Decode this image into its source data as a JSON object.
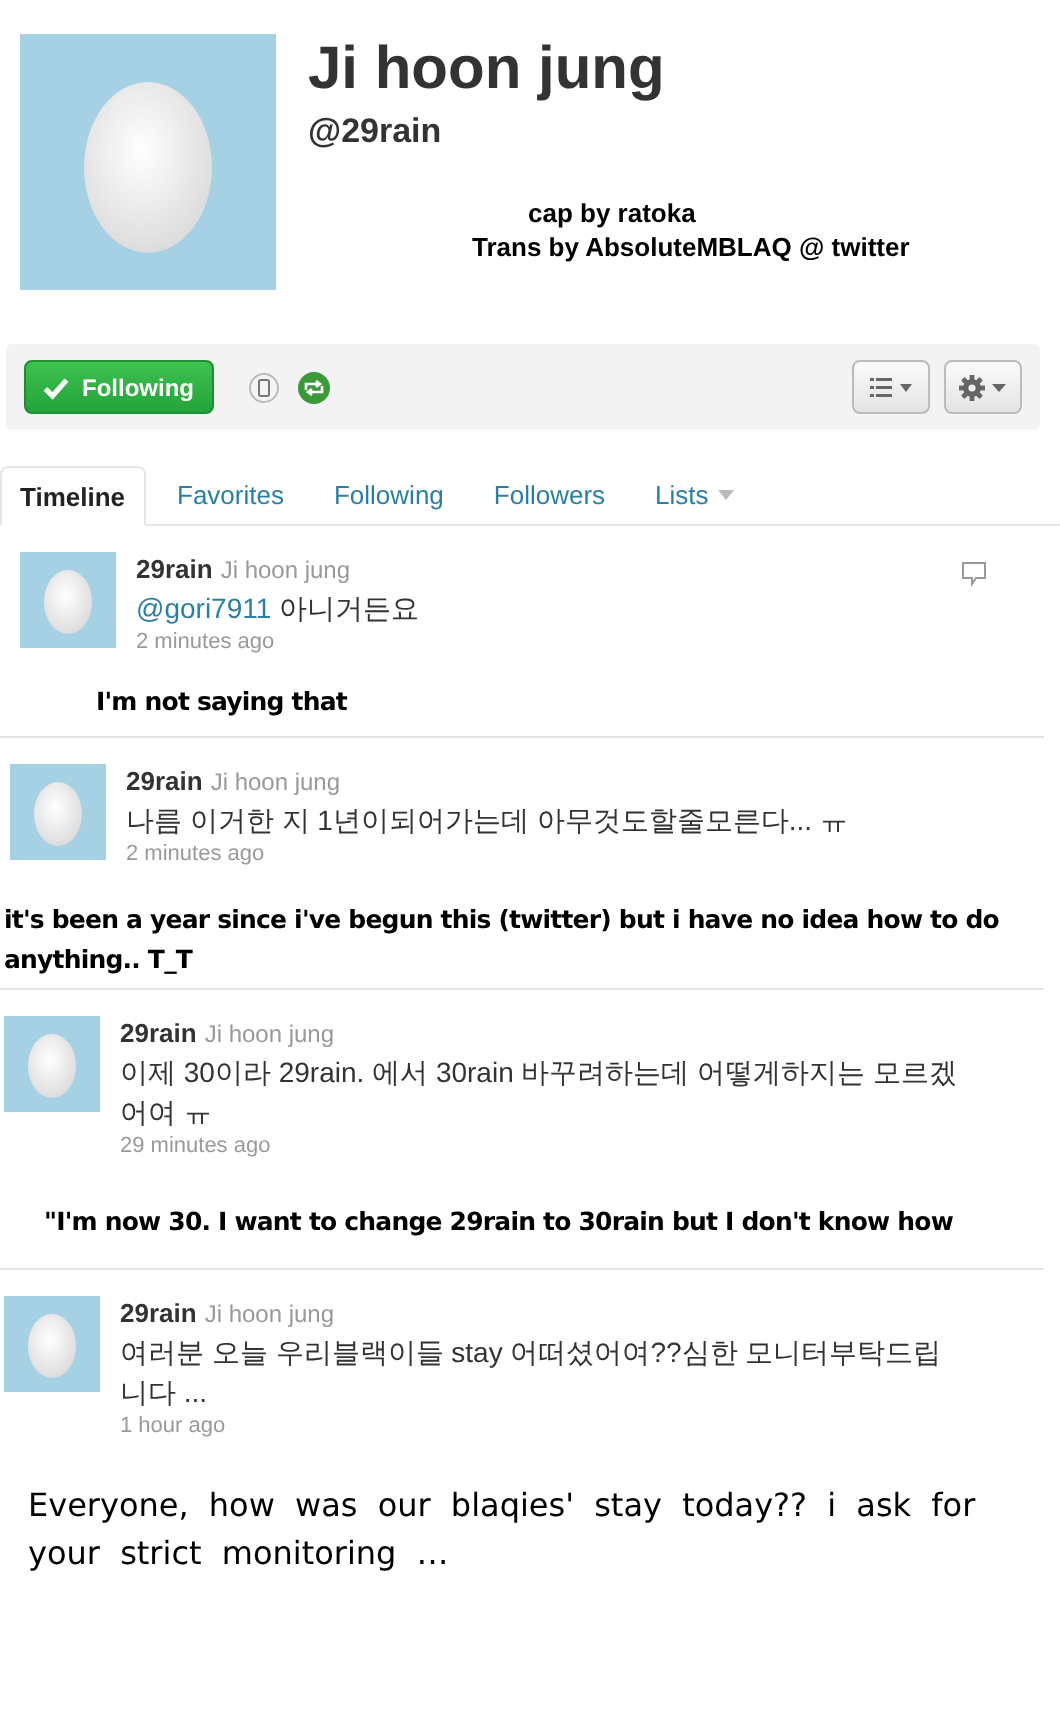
{
  "profile": {
    "name": "Ji hoon jung",
    "handle": "@29rain",
    "credits": [
      "cap by ratoka",
      "Trans by AbsoluteMBLAQ @ twitter"
    ]
  },
  "actions": {
    "follow_button": {
      "label": "Following",
      "following": true
    }
  },
  "tabs": [
    {
      "label": "Timeline",
      "selected": true,
      "dropdown": false
    },
    {
      "label": "Favorites",
      "selected": false,
      "dropdown": false
    },
    {
      "label": "Following",
      "selected": false,
      "dropdown": false
    },
    {
      "label": "Followers",
      "selected": false,
      "dropdown": false
    },
    {
      "label": "Lists",
      "selected": false,
      "dropdown": true
    }
  ],
  "tweets": [
    {
      "username": "29rain",
      "fullname": "Ji hoon jung",
      "mention": "@gori7911",
      "text": "아니거든요",
      "time": "2 minutes ago",
      "hovered": true,
      "translation": {
        "kind": "bold",
        "text": "I'm not saying that"
      }
    },
    {
      "username": "29rain",
      "fullname": "Ji hoon jung",
      "text": "나름 이거한 지 1년이되어가는데 아무것도할줄모른다... ㅠ",
      "time": "2 minutes ago",
      "hovered": false,
      "translation": {
        "kind": "bold",
        "text": "it's been a year since i've begun this (twitter) but i have no idea how to do anything.. T_T"
      }
    },
    {
      "username": "29rain",
      "fullname": "Ji hoon jung",
      "text": "이제 30이라 29rain. 에서 30rain 바꾸려하는데 어떻게하지는 모르겠어여 ㅠ",
      "time": "29 minutes ago",
      "hovered": false,
      "translation": {
        "kind": "bold",
        "text": "\"I'm now 30. I want to change 29rain to 30rain but I don't know how"
      }
    },
    {
      "username": "29rain",
      "fullname": "Ji hoon jung",
      "text": "여러분 오늘 우리블랙이들 stay 어떠셨어여??심한 모니터부탁드립니다 ...",
      "time": "1 hour ago",
      "hovered": false,
      "translation": {
        "kind": "plain",
        "text": "Everyone, how was our blaqies' stay today?? i ask for your strict monitoring …"
      }
    }
  ]
}
